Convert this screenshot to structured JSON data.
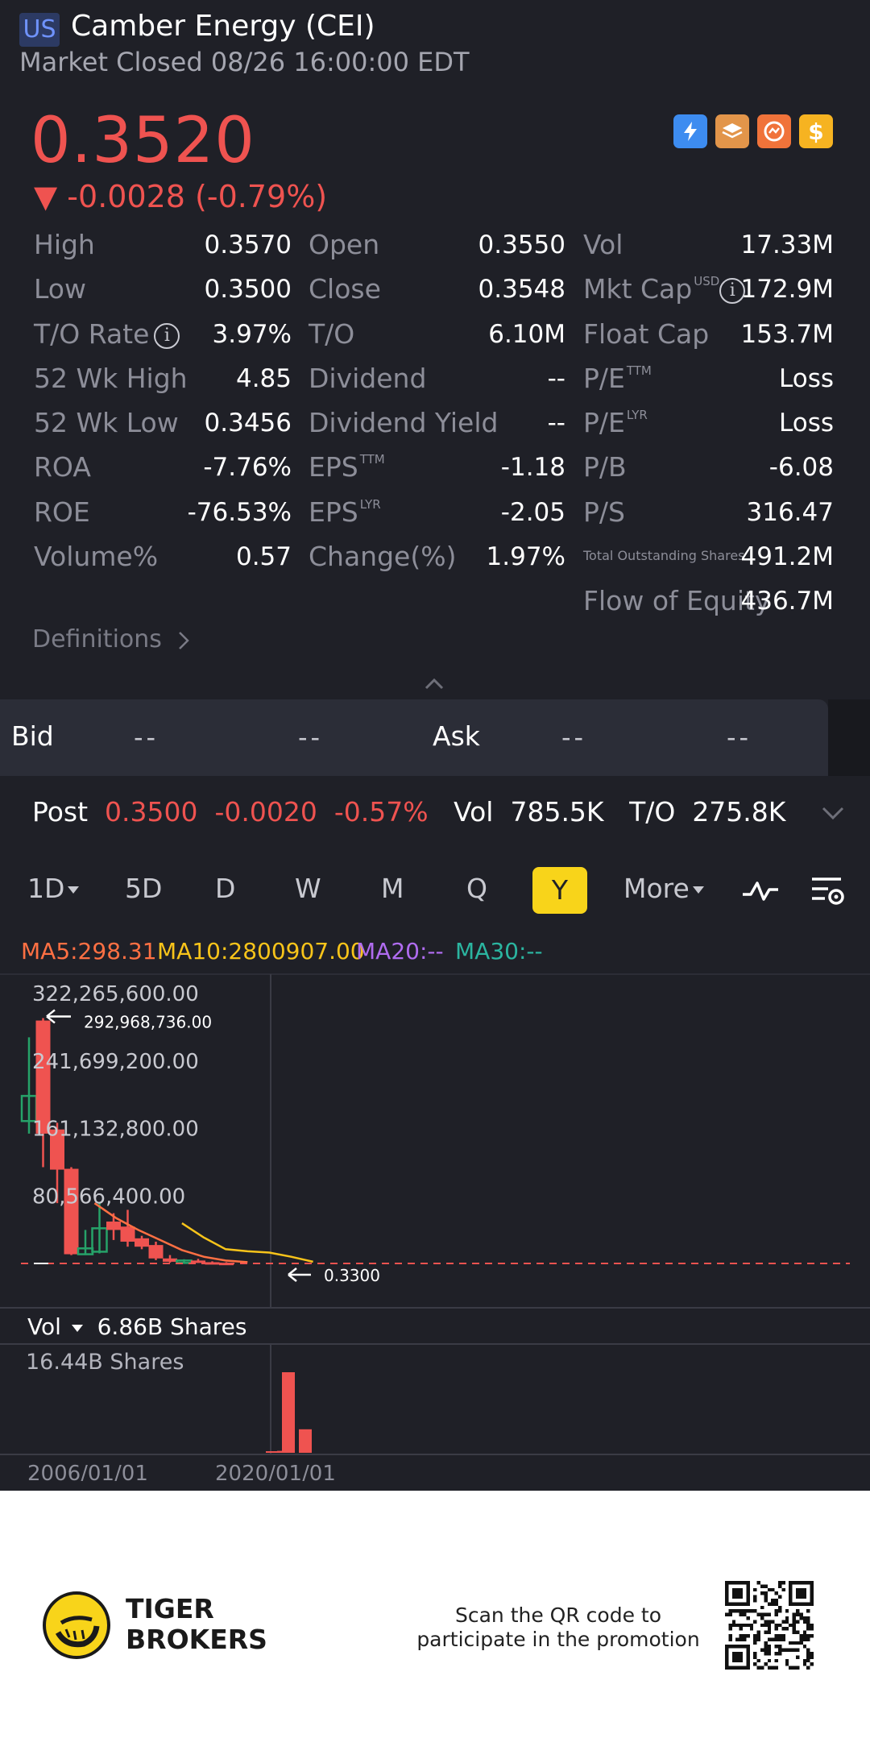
{
  "header": {
    "market": "US",
    "title": "Camber Energy (CEI)",
    "status": "Market Closed 08/26 16:00:00 EDT",
    "price": "0.3520",
    "change": "▼ -0.0028 (-0.79%)",
    "badges": [
      "lightning-1-icon",
      "layers-a-icon",
      "options-icon",
      "dollar-icon"
    ]
  },
  "stats": {
    "col1": [
      {
        "label": "High",
        "value": "0.3570"
      },
      {
        "label": "Low",
        "value": "0.3500"
      },
      {
        "label": "T/O Rate",
        "value": "3.97%"
      },
      {
        "label": "52 Wk High",
        "value": "4.85"
      },
      {
        "label": "52 Wk Low",
        "value": "0.3456"
      },
      {
        "label": "ROA",
        "value": "-7.76%"
      },
      {
        "label": "ROE",
        "value": "-76.53%"
      },
      {
        "label": "Volume%",
        "value": "0.57"
      }
    ],
    "col2": [
      {
        "label": "Open",
        "value": "0.3550"
      },
      {
        "label": "Close",
        "value": "0.3548"
      },
      {
        "label": "T/O",
        "value": "6.10M"
      },
      {
        "label": "Dividend",
        "value": "--"
      },
      {
        "label": "Dividend Yield",
        "value": "--"
      },
      {
        "label": "EPS",
        "sup": "TTM",
        "value": "-1.18"
      },
      {
        "label": "EPS",
        "sup": "LYR",
        "value": "-2.05"
      },
      {
        "label": "Change(%)",
        "value": "1.97%"
      }
    ],
    "col3": [
      {
        "label": "Vol",
        "value": "17.33M"
      },
      {
        "label": "Mkt Cap",
        "sup": "USD",
        "value": "172.9M"
      },
      {
        "label": "Float Cap",
        "value": "153.7M"
      },
      {
        "label": "P/E",
        "sup": "TTM",
        "value": "Loss"
      },
      {
        "label": "P/E",
        "sup": "LYR",
        "value": "Loss"
      },
      {
        "label": "P/B",
        "value": "-6.08"
      },
      {
        "label": "P/S",
        "value": "316.47"
      },
      {
        "label": "Total Outstanding Shares",
        "value": "491.2M"
      },
      {
        "label": "Flow of Equity",
        "value": "436.7M"
      }
    ],
    "definitions": "Definitions"
  },
  "bidask": {
    "bid_label": "Bid",
    "bid_price": "--",
    "bid_size": "--",
    "ask_label": "Ask",
    "ask_price": "--",
    "ask_size": "--"
  },
  "post": {
    "label": "Post",
    "price": "0.3500",
    "change": "-0.0020",
    "pct": "-0.57%",
    "vol_label": "Vol",
    "vol": "785.5K",
    "to_label": "T/O",
    "to": "275.8K"
  },
  "timeframes": [
    "1D",
    "5D",
    "D",
    "W",
    "M",
    "Q",
    "Y",
    "More"
  ],
  "active_timeframe": "Y",
  "ma": {
    "ma5": "MA5:298.31",
    "ma10": "MA10:2800907.00",
    "ma20": "MA20:--",
    "ma30": "MA30:--"
  },
  "colors": {
    "up": "#26a269",
    "down": "#ef5350",
    "ma5": "#ff7043",
    "ma10": "#f8c41a",
    "ma20": "#b06cf0",
    "ma30": "#2bb5a0",
    "accent": "#f8d41a"
  },
  "chart_data": {
    "type": "candlestick",
    "yticks": [
      "322,265,600.00",
      "241,699,200.00",
      "161,132,800.00",
      "80,566,400.00"
    ],
    "ytick_values": [
      322265600,
      241699200,
      161132800,
      80566400
    ],
    "ylim": [
      0,
      322265600
    ],
    "high_marker": "292,968,736.00",
    "high_value": 292968736,
    "current_marker": "0.3300",
    "current_value": 0.33,
    "x_labels": [
      "2006/01/01",
      "2020/01/01"
    ],
    "candles": [
      {
        "open": 170000000,
        "close": 200000000,
        "high": 270000000,
        "low": 155000000
      },
      {
        "open": 290000000,
        "close": 155000000,
        "high": 292968736,
        "low": 115000000
      },
      {
        "open": 160000000,
        "close": 112000000,
        "high": 168000000,
        "low": 72000000
      },
      {
        "open": 113000000,
        "close": 11000000,
        "high": 115000000,
        "low": 10000000
      },
      {
        "open": 11000000,
        "close": 18000000,
        "high": 40000000,
        "low": 10000000
      },
      {
        "open": 14000000,
        "close": 42000000,
        "high": 72000000,
        "low": 12000000
      },
      {
        "open": 50000000,
        "close": 40000000,
        "high": 60000000,
        "low": 28000000
      },
      {
        "open": 44000000,
        "close": 26000000,
        "high": 64000000,
        "low": 20000000
      },
      {
        "open": 30000000,
        "close": 20000000,
        "high": 33000000,
        "low": 17000000
      },
      {
        "open": 22000000,
        "close": 6000000,
        "high": 26000000,
        "low": 4000000
      },
      {
        "open": 6000000,
        "close": 2000000,
        "high": 10000000,
        "low": 1000000
      },
      {
        "open": 1500000,
        "close": 3500000,
        "high": 5000000,
        "low": 1000000
      },
      {
        "open": 3500000,
        "close": 1500000,
        "high": 5500000,
        "low": 800000
      },
      {
        "open": 1500000,
        "close": 800000,
        "high": 2500000,
        "low": 500000
      },
      {
        "open": 800000,
        "close": 300000,
        "high": 1500000,
        "low": 200000
      }
    ],
    "ma5_line": [
      72000000,
      54000000,
      40000000,
      28000000,
      16000000,
      8000000,
      3500000,
      1500000
    ],
    "ma10_line": [
      48000000,
      31000000,
      17000000,
      14500000,
      13000000,
      8000000,
      2000000
    ],
    "volume": {
      "label": "Vol",
      "current": "6.86B Shares",
      "max_label": "16.44B Shares",
      "max": 16440000000,
      "bars": [
        130000000,
        400000000,
        16440000000,
        4800000000
      ]
    }
  },
  "footer": {
    "brand_line1": "TIGER",
    "brand_line2": "BROKERS",
    "promo": "Scan the QR code to participate in the promotion"
  }
}
